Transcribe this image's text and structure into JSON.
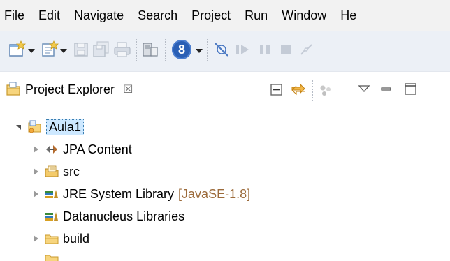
{
  "menu": [
    "File",
    "Edit",
    "Navigate",
    "Search",
    "Project",
    "Run",
    "Window",
    "He"
  ],
  "toolbar": {
    "icons": [
      "new-wizard-icon",
      "new-type-icon",
      "save-icon",
      "save-all-icon",
      "print-icon",
      "external-tools-icon",
      "run-badge-icon",
      "skip-breakpoints-icon",
      "resume-icon",
      "suspend-icon",
      "terminate-icon",
      "disconnect-icon"
    ],
    "run_badge": "8"
  },
  "view": {
    "title": "Project Explorer",
    "close_glyph": "☒",
    "icons": [
      "collapse-all-icon",
      "link-with-editor-icon",
      "focus-icon",
      "view-menu-icon",
      "minimize-icon",
      "maximize-icon"
    ]
  },
  "tree": {
    "project": {
      "label": "Aula1",
      "icon": "project-icon",
      "expanded": true
    },
    "children": [
      {
        "label": "JPA Content",
        "icon": "jpa-icon",
        "decoration": "",
        "expandable": true
      },
      {
        "label": "src",
        "icon": "source-folder-icon",
        "decoration": "",
        "expandable": true
      },
      {
        "label": "JRE System Library",
        "icon": "library-icon",
        "decoration": "[JavaSE-1.8]",
        "expandable": true
      },
      {
        "label": "Datanucleus Libraries",
        "icon": "library-icon",
        "decoration": "",
        "expandable": false
      },
      {
        "label": "build",
        "icon": "folder-icon",
        "decoration": "",
        "expandable": true
      }
    ]
  },
  "colors": {
    "menubar_bg": "#f2f2f2",
    "toolbar_bg": "#ecf0f6",
    "selection_bg": "#cde8ff",
    "decoration_text": "#9c6b3b"
  }
}
